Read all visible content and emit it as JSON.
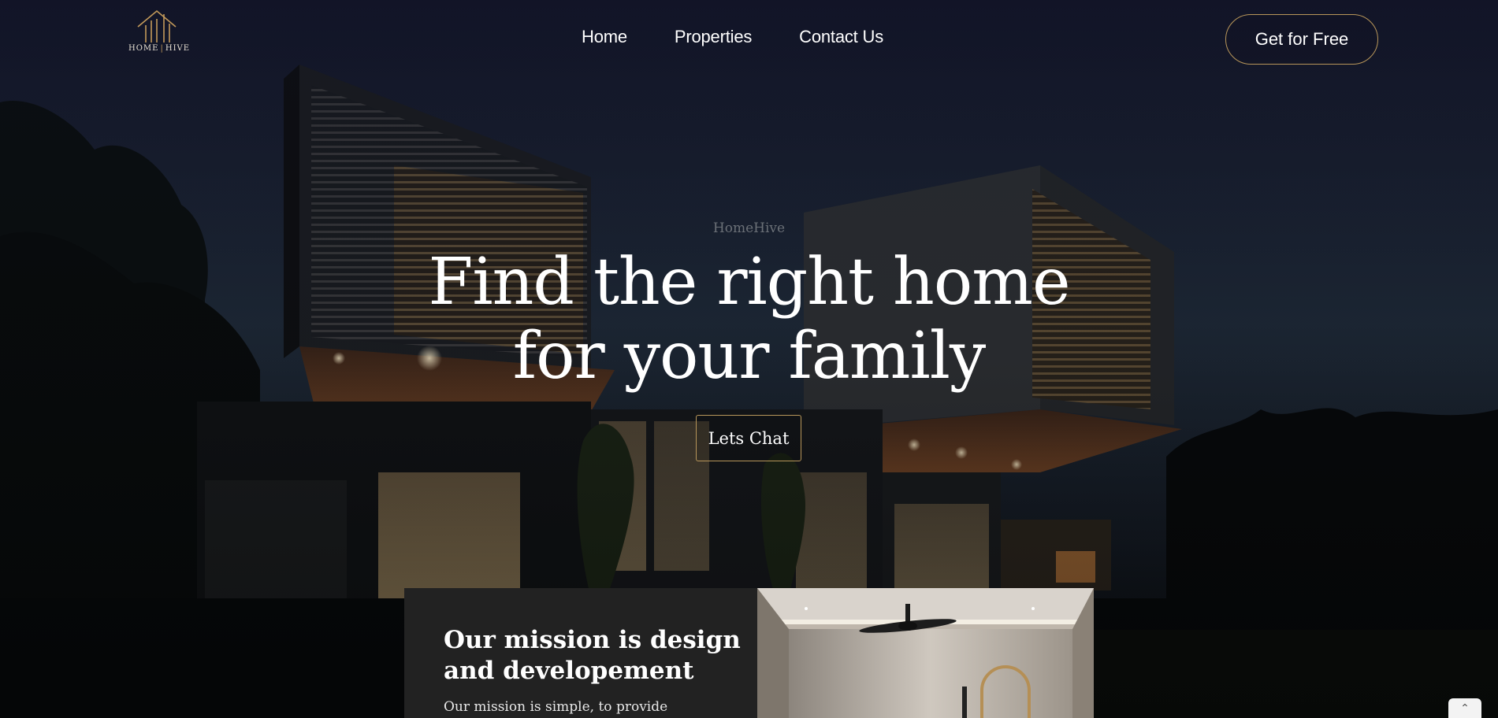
{
  "logo": {
    "name_left": "HOME",
    "separator": "|",
    "name_right": "HIVE",
    "accent_color": "#c39a5a"
  },
  "nav": {
    "items": [
      {
        "label": "Home"
      },
      {
        "label": "Properties"
      },
      {
        "label": "Contact Us"
      }
    ]
  },
  "header": {
    "cta_label": "Get for Free"
  },
  "hero": {
    "eyebrow": "HomeHive",
    "headline_line1": "Find the right home",
    "headline_line2": "for your family",
    "button_label": "Lets Chat"
  },
  "mission": {
    "title": "Our mission is design and developement",
    "text": "Our mission is simple, to provide"
  },
  "scroll_top": {
    "icon": "chevron-up-icon"
  },
  "colors": {
    "accent": "#b8965a",
    "card_bg": "#222222",
    "text": "#ffffff"
  }
}
